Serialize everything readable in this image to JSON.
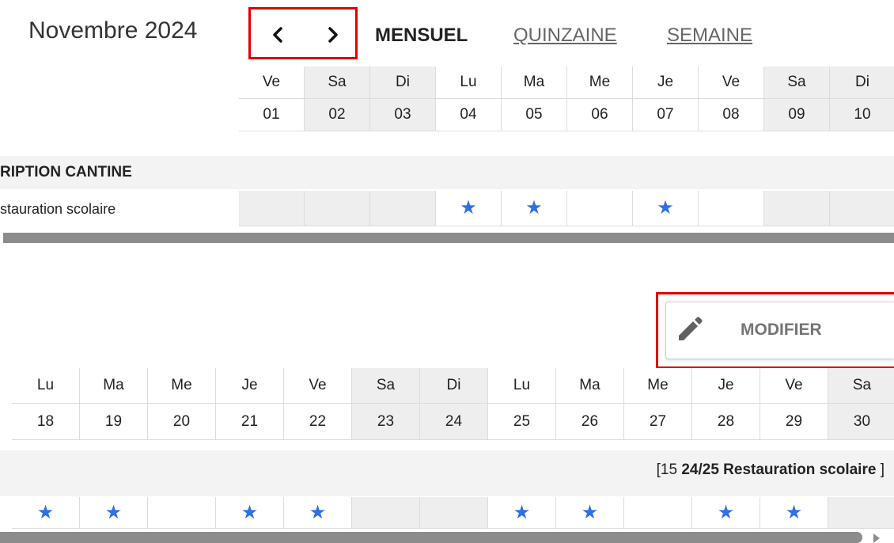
{
  "header": {
    "month_title": "Novembre 2024",
    "prev_label": "‹",
    "next_label": "›",
    "views": [
      "MENSUEL",
      "QUINZAINE",
      "SEMAINE"
    ],
    "active_view": "MENSUEL"
  },
  "top_calendar": {
    "days": [
      {
        "dow": "Ve",
        "date": "01",
        "weekend": false
      },
      {
        "dow": "Sa",
        "date": "02",
        "weekend": true
      },
      {
        "dow": "Di",
        "date": "03",
        "weekend": true
      },
      {
        "dow": "Lu",
        "date": "04",
        "weekend": false
      },
      {
        "dow": "Ma",
        "date": "05",
        "weekend": false
      },
      {
        "dow": "Me",
        "date": "06",
        "weekend": false
      },
      {
        "dow": "Je",
        "date": "07",
        "weekend": false
      },
      {
        "dow": "Ve",
        "date": "08",
        "weekend": false
      },
      {
        "dow": "Sa",
        "date": "09",
        "weekend": true
      },
      {
        "dow": "Di",
        "date": "10",
        "weekend": true
      }
    ],
    "section_label": "RIPTION CANTINE",
    "row_label": "stauration scolaire",
    "row_cells": [
      "empty",
      "empty",
      "empty",
      "star",
      "star",
      "blank",
      "star",
      "blank",
      "empty",
      "empty"
    ]
  },
  "modify_button": {
    "label": "MODIFIER",
    "icon": "pencil-icon"
  },
  "bottom_calendar": {
    "days": [
      {
        "dow": "Lu",
        "date": "18",
        "weekend": false
      },
      {
        "dow": "Ma",
        "date": "19",
        "weekend": false
      },
      {
        "dow": "Me",
        "date": "20",
        "weekend": false
      },
      {
        "dow": "Je",
        "date": "21",
        "weekend": false
      },
      {
        "dow": "Ve",
        "date": "22",
        "weekend": false
      },
      {
        "dow": "Sa",
        "date": "23",
        "weekend": true
      },
      {
        "dow": "Di",
        "date": "24",
        "weekend": true
      },
      {
        "dow": "Lu",
        "date": "25",
        "weekend": false
      },
      {
        "dow": "Ma",
        "date": "26",
        "weekend": false
      },
      {
        "dow": "Me",
        "date": "27",
        "weekend": false
      },
      {
        "dow": "Je",
        "date": "28",
        "weekend": false
      },
      {
        "dow": "Ve",
        "date": "29",
        "weekend": false
      },
      {
        "dow": "Sa",
        "date": "30",
        "weekend": true
      }
    ],
    "period_prefix": "[15 ",
    "period_bold": "24/25 Restauration scolaire",
    "period_suffix": " ]",
    "row_cells": [
      "star",
      "star",
      "blank",
      "star",
      "star",
      "empty",
      "empty",
      "star",
      "star",
      "blank",
      "star",
      "star",
      "empty"
    ]
  },
  "colors": {
    "star": "#2f6fe8",
    "highlight": "#e00000",
    "weekend_bg": "#eeeeee",
    "scrollbar": "#8c8c8c"
  }
}
